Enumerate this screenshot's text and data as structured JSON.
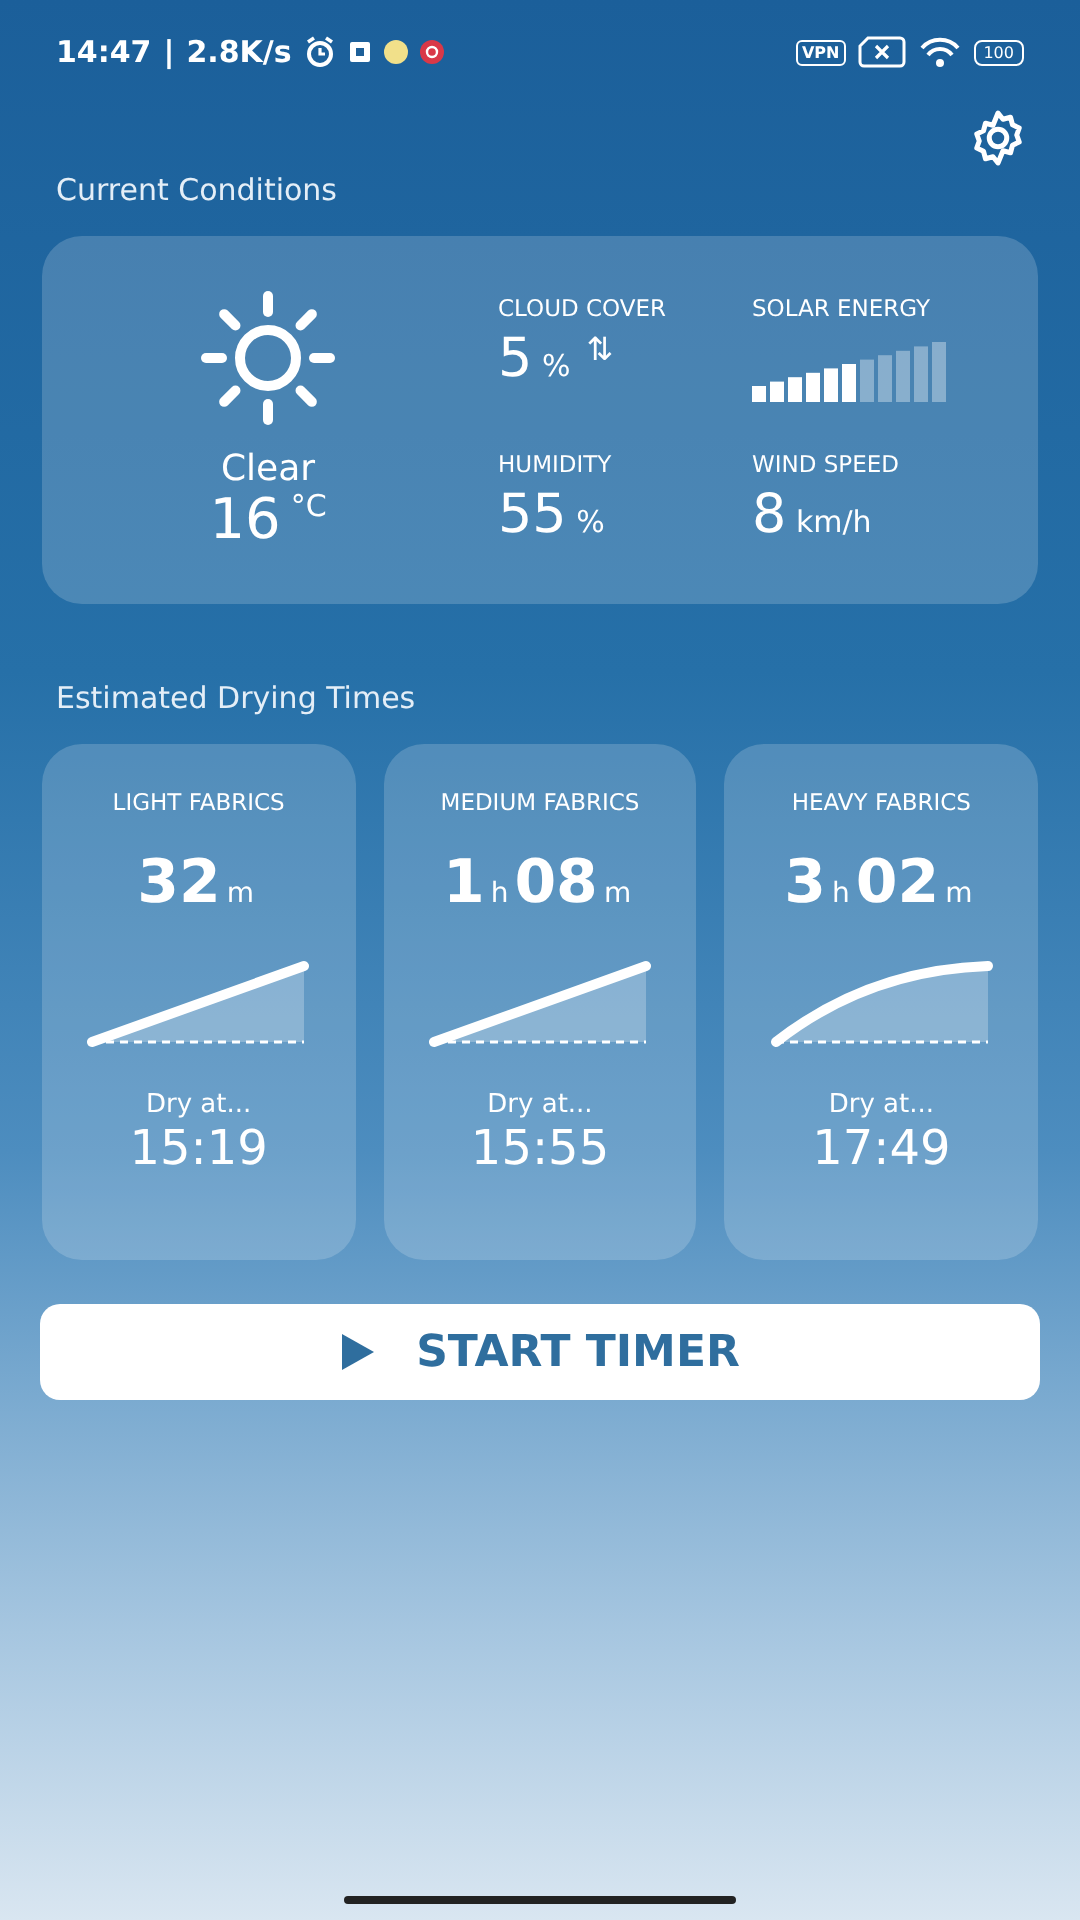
{
  "status_bar": {
    "time": "14:47",
    "separator": "|",
    "speed": "2.8K/s",
    "vpn": "VPN",
    "battery": "100"
  },
  "current_conditions": {
    "title": "Current Conditions",
    "condition": "Clear",
    "temperature": {
      "value": "16",
      "unit": "°C"
    },
    "stats": [
      {
        "kind": "reading",
        "label": "CLOUD COVER",
        "value": "5",
        "unit": "%",
        "trend": "⇅"
      },
      {
        "kind": "meter",
        "label": "SOLAR ENERGY",
        "level": 0.55
      },
      {
        "kind": "reading",
        "label": "HUMIDITY",
        "value": "55",
        "unit": "%"
      },
      {
        "kind": "reading",
        "label": "WIND SPEED",
        "value": "8",
        "unit": "km/h"
      }
    ]
  },
  "drying": {
    "title": "Estimated Drying Times",
    "cards": [
      {
        "label": "LIGHT FABRICS",
        "duration": [
          {
            "value": "32",
            "unit": "m"
          }
        ],
        "kind": "linear",
        "dry_label": "Dry at...",
        "dry_time": "15:19"
      },
      {
        "label": "MEDIUM FABRICS",
        "duration": [
          {
            "value": "1",
            "unit": "h"
          },
          {
            "value": "08",
            "unit": "m"
          }
        ],
        "kind": "linear",
        "dry_label": "Dry at...",
        "dry_time": "15:55"
      },
      {
        "label": "HEAVY FABRICS",
        "duration": [
          {
            "value": "3",
            "unit": "h"
          },
          {
            "value": "02",
            "unit": "m"
          }
        ],
        "kind": "curved",
        "dry_label": "Dry at...",
        "dry_time": "17:49"
      }
    ]
  },
  "start_button": {
    "label": "START TIMER"
  }
}
